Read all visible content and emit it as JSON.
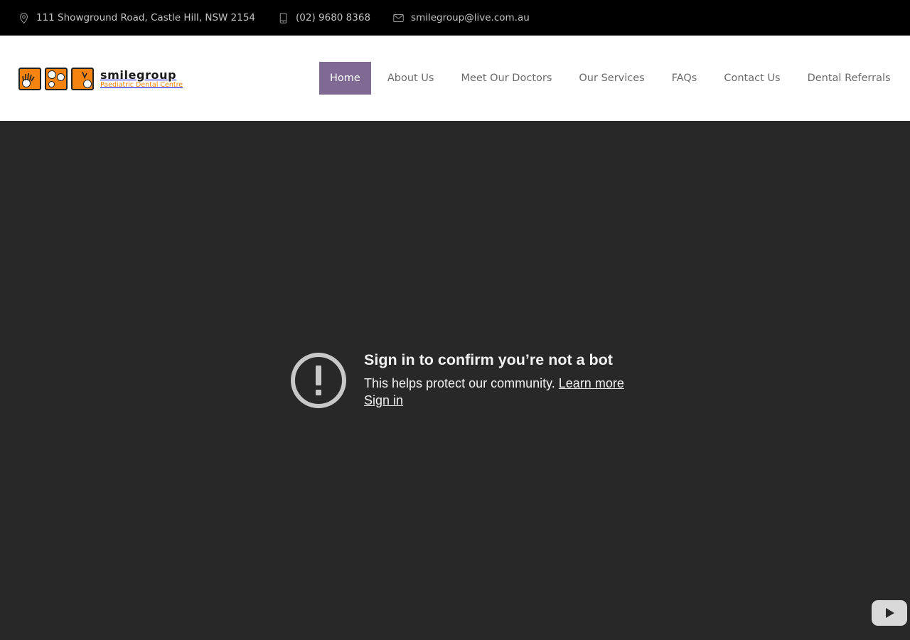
{
  "topbar": {
    "address": "111 Showground Road, Castle Hill, NSW 2154",
    "phone": "(02) 9680 8368",
    "email": "smilegroup@live.com.au",
    "address_icon": "map-pin-icon",
    "phone_icon": "mobile-phone-icon",
    "email_icon": "envelope-icon"
  },
  "logo": {
    "title": "smilegroup",
    "subtitle": "Paediatric Dental Centre",
    "brand_color": "#f5830f"
  },
  "nav": {
    "active_color": "#7f6a94",
    "items": [
      {
        "label": "Home",
        "active": true
      },
      {
        "label": "About Us",
        "active": false
      },
      {
        "label": "Meet Our Doctors",
        "active": false
      },
      {
        "label": "Our Services",
        "active": false
      },
      {
        "label": "FAQs",
        "active": false
      },
      {
        "label": "Contact Us",
        "active": false
      },
      {
        "label": "Dental Referrals",
        "active": false
      }
    ]
  },
  "video": {
    "background": "#282828",
    "notice_icon": "exclamation-circle-icon",
    "title": "Sign in to confirm you’re not a bot",
    "message": "This helps protect our community. ",
    "learn_more": "Learn more",
    "sign_in": "Sign in",
    "player_icon": "youtube-play-icon"
  }
}
